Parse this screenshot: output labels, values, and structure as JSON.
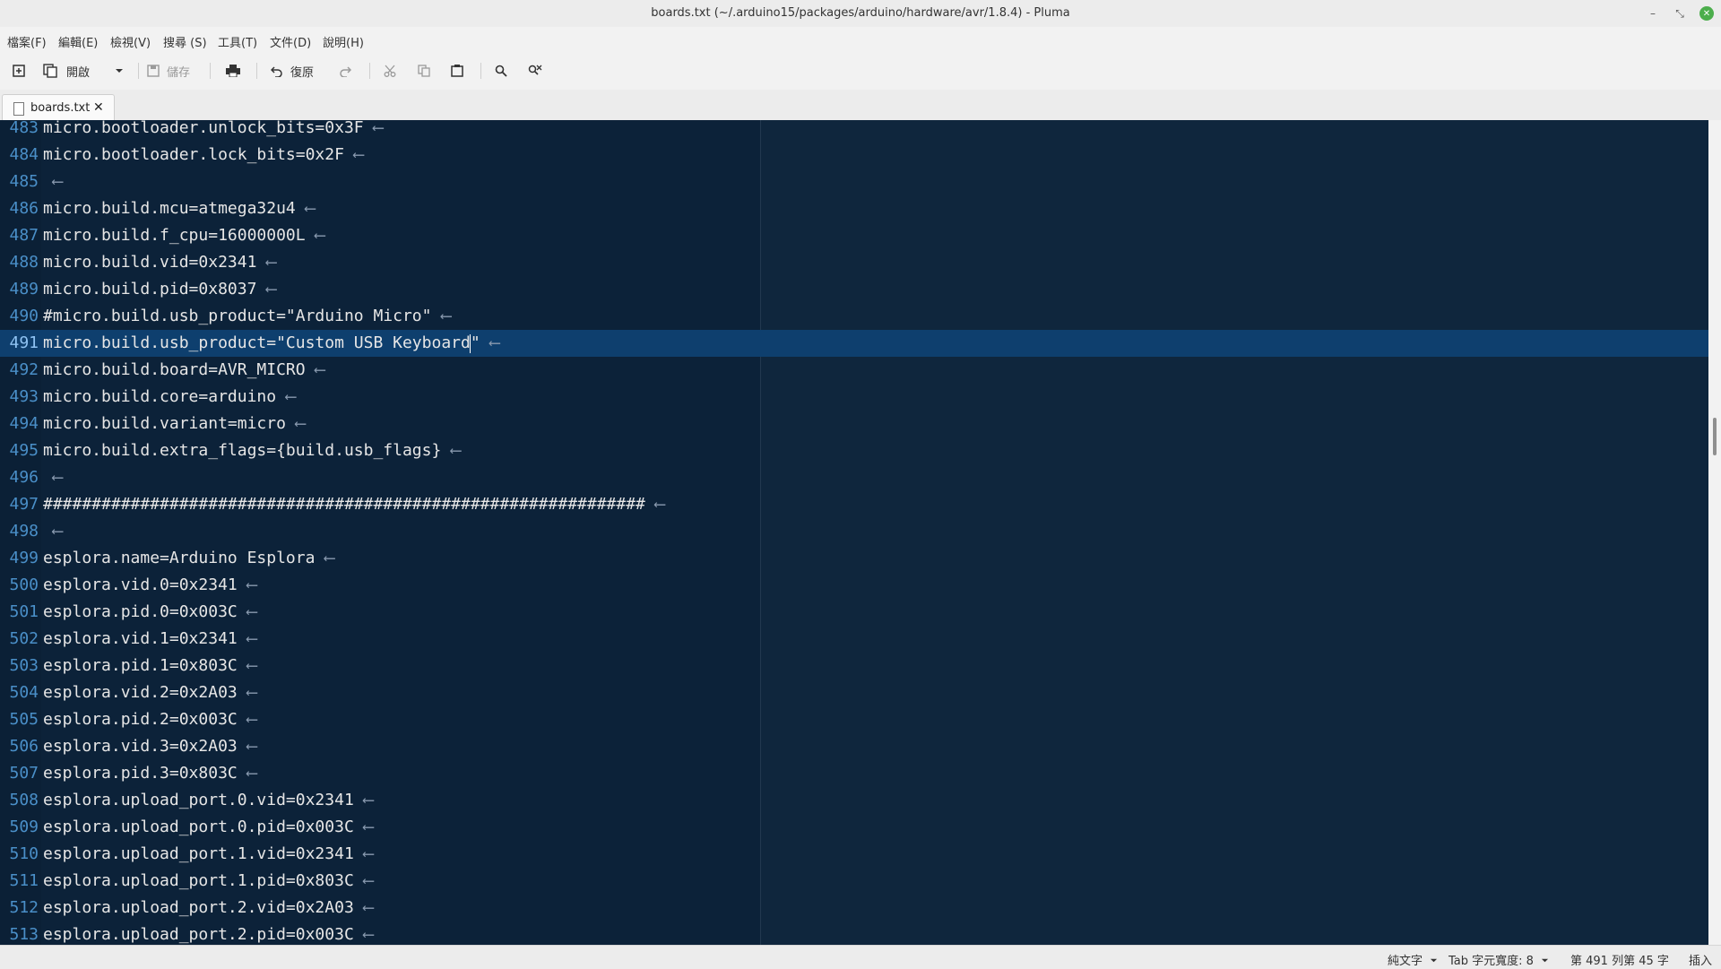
{
  "window": {
    "title": "boards.txt (~/.arduino15/packages/arduino/hardware/avr/1.8.4) - Pluma",
    "minimize_glyph": "–",
    "restore_glyph": "⤡",
    "close_glyph": "✕"
  },
  "menubar": {
    "items": [
      "檔案(F)",
      "編輯(E)",
      "檢視(V)",
      "搜尋 (S)",
      "工具(T)",
      "文件(D)",
      "說明(H)"
    ]
  },
  "toolbar": {
    "open_label": "開啟",
    "save_label": "儲存",
    "undo_label": "復原"
  },
  "tabs": [
    {
      "label": "boards.txt",
      "close_glyph": "✕"
    }
  ],
  "editor": {
    "accent_bg": "#0c2239",
    "current_line": 491,
    "return_glyph": "⟵",
    "lines": [
      {
        "n": "483",
        "text": "micro.bootloader.unlock_bits=0x3F"
      },
      {
        "n": "484",
        "text": "micro.bootloader.lock_bits=0x2F"
      },
      {
        "n": "485",
        "text": ""
      },
      {
        "n": "486",
        "text": "micro.build.mcu=atmega32u4"
      },
      {
        "n": "487",
        "text": "micro.build.f_cpu=16000000L"
      },
      {
        "n": "488",
        "text": "micro.build.vid=0x2341"
      },
      {
        "n": "489",
        "text": "micro.build.pid=0x8037"
      },
      {
        "n": "490",
        "text": "#micro.build.usb_product=\"Arduino Micro\""
      },
      {
        "n": "491",
        "text": "micro.build.usb_product=\"Custom USB Keyboard\""
      },
      {
        "n": "492",
        "text": "micro.build.board=AVR_MICRO"
      },
      {
        "n": "493",
        "text": "micro.build.core=arduino"
      },
      {
        "n": "494",
        "text": "micro.build.variant=micro"
      },
      {
        "n": "495",
        "text": "micro.build.extra_flags={build.usb_flags}"
      },
      {
        "n": "496",
        "text": ""
      },
      {
        "n": "497",
        "text": "##############################################################"
      },
      {
        "n": "498",
        "text": ""
      },
      {
        "n": "499",
        "text": "esplora.name=Arduino Esplora"
      },
      {
        "n": "500",
        "text": "esplora.vid.0=0x2341"
      },
      {
        "n": "501",
        "text": "esplora.pid.0=0x003C"
      },
      {
        "n": "502",
        "text": "esplora.vid.1=0x2341"
      },
      {
        "n": "503",
        "text": "esplora.pid.1=0x803C"
      },
      {
        "n": "504",
        "text": "esplora.vid.2=0x2A03"
      },
      {
        "n": "505",
        "text": "esplora.pid.2=0x003C"
      },
      {
        "n": "506",
        "text": "esplora.vid.3=0x2A03"
      },
      {
        "n": "507",
        "text": "esplora.pid.3=0x803C"
      },
      {
        "n": "508",
        "text": "esplora.upload_port.0.vid=0x2341"
      },
      {
        "n": "509",
        "text": "esplora.upload_port.0.pid=0x003C"
      },
      {
        "n": "510",
        "text": "esplora.upload_port.1.vid=0x2341"
      },
      {
        "n": "511",
        "text": "esplora.upload_port.1.pid=0x803C"
      },
      {
        "n": "512",
        "text": "esplora.upload_port.2.vid=0x2A03"
      },
      {
        "n": "513",
        "text": "esplora.upload_port.2.pid=0x003C"
      }
    ]
  },
  "statusbar": {
    "language": "純文字",
    "tab_width": "Tab 字元寬度: 8",
    "position": "第 491 列第 45 字",
    "mode": "插入"
  }
}
